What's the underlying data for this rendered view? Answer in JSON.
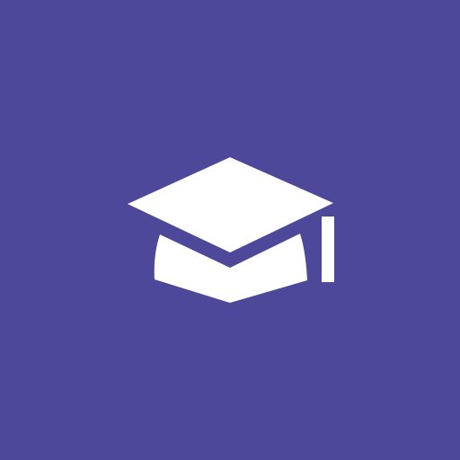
{
  "app_icon": {
    "icon": "graduation-cap-icon",
    "background_color": "#4E489A",
    "glyph_color": "#FFFFFF"
  }
}
